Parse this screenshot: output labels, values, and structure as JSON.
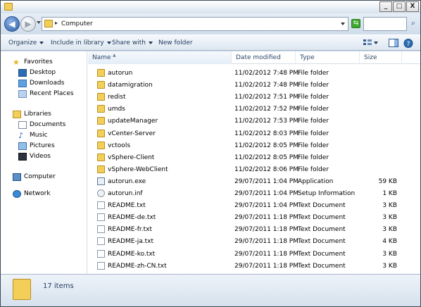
{
  "window": {
    "min": "_",
    "max": "□",
    "close": "X"
  },
  "address": {
    "path": "Computer",
    "separator": "▸"
  },
  "toolbar": {
    "organize": "Organize",
    "include": "Include in library",
    "share": "Share with",
    "new_folder": "New folder"
  },
  "nav": {
    "favorites": {
      "label": "Favorites",
      "items": [
        "Desktop",
        "Downloads",
        "Recent Places"
      ]
    },
    "libraries": {
      "label": "Libraries",
      "items": [
        "Documents",
        "Music",
        "Pictures",
        "Videos"
      ]
    },
    "computer": "Computer",
    "network": "Network"
  },
  "columns": {
    "name": "Name",
    "date": "Date modified",
    "type": "Type",
    "size": "Size"
  },
  "files": [
    {
      "name": "autorun",
      "date": "11/02/2012 7:48 PM",
      "type": "File folder",
      "size": "",
      "icon": "folder"
    },
    {
      "name": "datamigration",
      "date": "11/02/2012 7:48 PM",
      "type": "File folder",
      "size": "",
      "icon": "folder"
    },
    {
      "name": "redist",
      "date": "11/02/2012 7:51 PM",
      "type": "File folder",
      "size": "",
      "icon": "folder"
    },
    {
      "name": "umds",
      "date": "11/02/2012 7:52 PM",
      "type": "File folder",
      "size": "",
      "icon": "folder"
    },
    {
      "name": "updateManager",
      "date": "11/02/2012 7:53 PM",
      "type": "File folder",
      "size": "",
      "icon": "folder"
    },
    {
      "name": "vCenter-Server",
      "date": "11/02/2012 8:03 PM",
      "type": "File folder",
      "size": "",
      "icon": "folder"
    },
    {
      "name": "vctools",
      "date": "11/02/2012 8:05 PM",
      "type": "File folder",
      "size": "",
      "icon": "folder"
    },
    {
      "name": "vSphere-Client",
      "date": "11/02/2012 8:05 PM",
      "type": "File folder",
      "size": "",
      "icon": "folder"
    },
    {
      "name": "vSphere-WebClient",
      "date": "11/02/2012 8:06 PM",
      "type": "File folder",
      "size": "",
      "icon": "folder"
    },
    {
      "name": "autorun.exe",
      "date": "29/07/2011 1:04 PM",
      "type": "Application",
      "size": "59 KB",
      "icon": "exe"
    },
    {
      "name": "autorun.inf",
      "date": "29/07/2011 1:04 PM",
      "type": "Setup Information",
      "size": "1 KB",
      "icon": "inf"
    },
    {
      "name": "README.txt",
      "date": "29/07/2011 1:04 PM",
      "type": "Text Document",
      "size": "3 KB",
      "icon": "txt"
    },
    {
      "name": "README-de.txt",
      "date": "29/07/2011 1:18 PM",
      "type": "Text Document",
      "size": "3 KB",
      "icon": "txt"
    },
    {
      "name": "README-fr.txt",
      "date": "29/07/2011 1:18 PM",
      "type": "Text Document",
      "size": "3 KB",
      "icon": "txt"
    },
    {
      "name": "README-ja.txt",
      "date": "29/07/2011 1:18 PM",
      "type": "Text Document",
      "size": "4 KB",
      "icon": "txt"
    },
    {
      "name": "README-ko.txt",
      "date": "29/07/2011 1:18 PM",
      "type": "Text Document",
      "size": "3 KB",
      "icon": "txt"
    },
    {
      "name": "README-zh-CN.txt",
      "date": "29/07/2011 1:18 PM",
      "type": "Text Document",
      "size": "3 KB",
      "icon": "txt"
    }
  ],
  "status": {
    "count": "17 items"
  }
}
